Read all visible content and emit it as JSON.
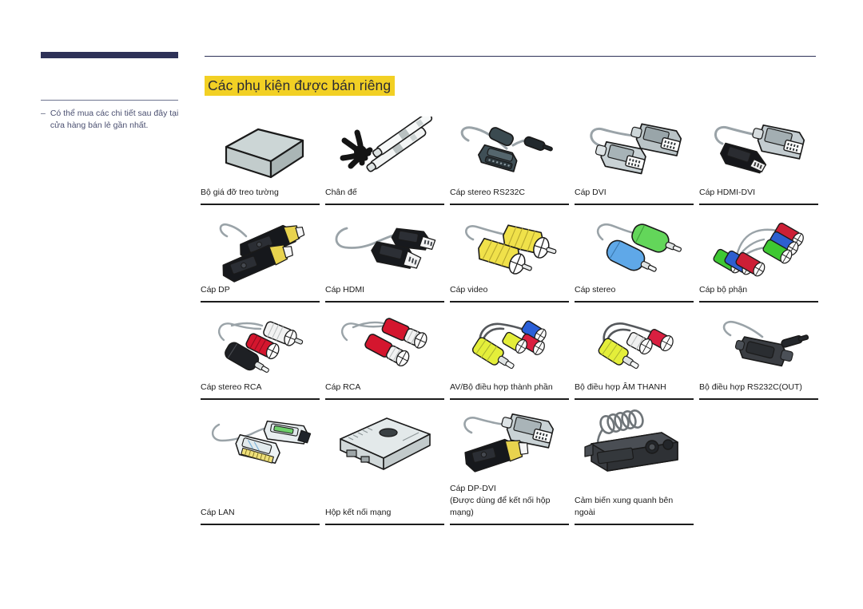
{
  "document": {
    "title": "Các phụ kiện được bán riêng",
    "title_highlight_color": "#F2D024",
    "accent_bar_color": "#2E3258"
  },
  "sidebar": {
    "note_dash": "–",
    "note_text": "Có thể mua các chi tiết sau đây tại cửa hàng bán lẻ gần nhất."
  },
  "accessories": {
    "rows": [
      [
        {
          "label": "Bộ giá đỡ treo tường",
          "icon": "wall-mount-bracket"
        },
        {
          "label": "Chân đế",
          "icon": "stand-base"
        },
        {
          "label": "Cáp stereo RS232C",
          "icon": "rs232c-stereo-cable"
        },
        {
          "label": "Cáp DVI",
          "icon": "dvi-cable"
        },
        {
          "label": "Cáp HDMI-DVI",
          "icon": "hdmi-dvi-cable"
        }
      ],
      [
        {
          "label": "Cáp DP",
          "icon": "dp-cable"
        },
        {
          "label": "Cáp HDMI",
          "icon": "hdmi-cable"
        },
        {
          "label": "Cáp video",
          "icon": "video-cable"
        },
        {
          "label": "Cáp stereo",
          "icon": "stereo-cable"
        },
        {
          "label": "Cáp bộ phận",
          "icon": "component-cable"
        }
      ],
      [
        {
          "label": "Cáp stereo RCA",
          "icon": "stereo-rca-cable"
        },
        {
          "label": "Cáp RCA",
          "icon": "rca-cable"
        },
        {
          "label": "AV/Bộ điều hợp thành phần",
          "icon": "av-component-adapter"
        },
        {
          "label": "Bộ điều hợp ÂM THANH",
          "icon": "audio-adapter"
        },
        {
          "label": "Bộ điều hợp RS232C(OUT)",
          "icon": "rs232c-out-adapter"
        }
      ],
      [
        {
          "label": "Cáp LAN",
          "sub": "",
          "icon": "lan-cable"
        },
        {
          "label": "Hộp kết nối mạng",
          "sub": "",
          "icon": "network-box"
        },
        {
          "label": "Cáp DP-DVI",
          "sub": "(Được dùng để kết nối hộp mạng)",
          "icon": "dp-dvi-cable"
        },
        {
          "label": "Cảm biến xung quanh bên ngoài",
          "sub": "",
          "icon": "ambient-sensor"
        }
      ]
    ]
  }
}
